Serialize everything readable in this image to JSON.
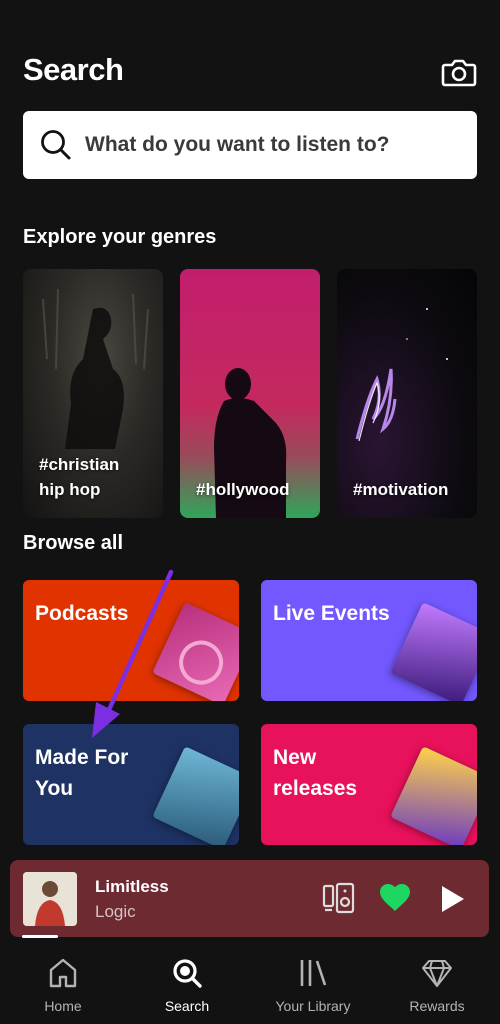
{
  "header": {
    "title": "Search"
  },
  "search": {
    "placeholder": "What do you want to listen to?"
  },
  "sections": {
    "genres_title": "Explore your genres",
    "browse_title": "Browse all"
  },
  "genres": [
    {
      "line1": "#christian",
      "line2": "hip hop"
    },
    {
      "line1": "#hollywood",
      "line2": ""
    },
    {
      "line1": "#motivation",
      "line2": ""
    }
  ],
  "browse": [
    {
      "line1": "Podcasts",
      "line2": "",
      "color": "#e13300"
    },
    {
      "line1": "Live Events",
      "line2": "",
      "color": "#7358ff"
    },
    {
      "line1": "Made For",
      "line2": "You",
      "color": "#1e3264"
    },
    {
      "line1": "New",
      "line2": "releases",
      "color": "#e8115b"
    }
  ],
  "now_playing": {
    "title": "Limitless",
    "artist": "Logic",
    "liked": true,
    "progress_fraction": 0.08
  },
  "nav": [
    {
      "label": "Home",
      "icon": "home-icon"
    },
    {
      "label": "Search",
      "icon": "search-icon"
    },
    {
      "label": "Your Library",
      "icon": "library-icon"
    },
    {
      "label": "Rewards",
      "icon": "diamond-icon"
    }
  ],
  "colors": {
    "background": "#121212",
    "accent_green": "#1ed760",
    "now_playing_bg": "#6e2a31",
    "annotation_arrow": "#7b2fe0"
  }
}
